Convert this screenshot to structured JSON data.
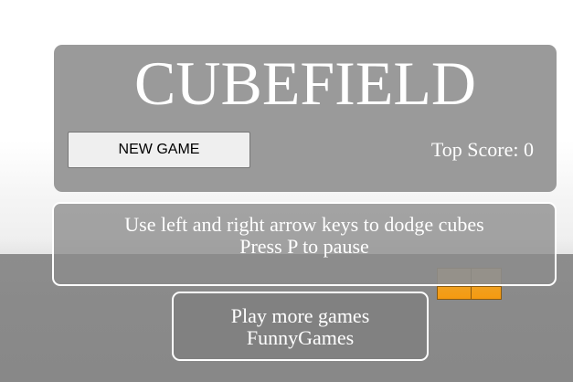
{
  "game": {
    "title": "CUBEFIELD",
    "new_game_label": "NEW GAME",
    "top_score_label": "Top Score: 0"
  },
  "instructions": {
    "line1": "Use left and right arrow keys to dodge cubes",
    "line2": "Press P to pause"
  },
  "more_games": {
    "line1": "Play more games",
    "line2": "FunnyGames"
  },
  "colors": {
    "cube_front": "#f59a10",
    "cube_top": "#b8a585",
    "ground": "#8a8a8a",
    "panel": "#9a9a9a",
    "text": "#ffffff"
  }
}
